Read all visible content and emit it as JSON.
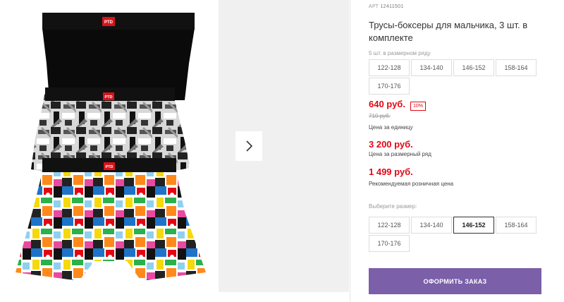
{
  "product": {
    "sku_label": "АРТ",
    "sku_number": "12411501",
    "title": "Трусы-боксеры для мальчика, 3 шт. в комплекте",
    "brand_tag": "PTD"
  },
  "size_range": {
    "caption": "5 шт. в размерном ряду",
    "sizes": [
      "122-128",
      "134-140",
      "146-152",
      "158-164",
      "170-176"
    ]
  },
  "pricing": {
    "unit_price": "640 руб.",
    "discount": "10%",
    "old_price": "710 руб.",
    "unit_caption": "Цена за единицу",
    "row_price": "3 200 руб.",
    "row_caption": "Цена за размерный ряд",
    "retail_price": "1 499 руб.",
    "retail_caption": "Рекомендуемая розничная цена"
  },
  "size_select": {
    "label": "Выберите размер:",
    "sizes": [
      "122-128",
      "134-140",
      "146-152",
      "158-164",
      "170-176"
    ],
    "selected": "146-152"
  },
  "actions": {
    "order_label": "ОФОРМИТЬ ЗАКАЗ"
  },
  "icons": {
    "next": "chevron-right-icon"
  },
  "colors": {
    "price_red": "#e30613",
    "order_button": "#7b5fa8"
  }
}
